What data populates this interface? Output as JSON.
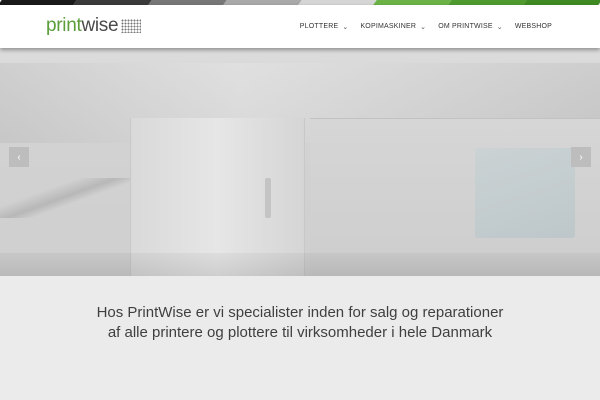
{
  "brand": {
    "logo_part1": "print",
    "logo_part2": "wise",
    "accent_color": "#5b9e3a"
  },
  "top_stripe_colors": [
    "#1a1a1a",
    "#3a3a3a",
    "#777777",
    "#a9a9a9",
    "#d6d6d6",
    "#6bb346",
    "#4f9a2f",
    "#3f8a22"
  ],
  "nav": {
    "items": [
      {
        "label": "PLOTTERE",
        "has_dropdown": true,
        "icon": "chevron-down-icon"
      },
      {
        "label": "KOPIMASKINER",
        "has_dropdown": true,
        "icon": "chevron-down-icon"
      },
      {
        "label": "OM PRINTWISE",
        "has_dropdown": true,
        "icon": "chevron-down-icon"
      },
      {
        "label": "WEBSHOP",
        "has_dropdown": false
      }
    ]
  },
  "slider": {
    "prev_icon": "chevron-left-icon",
    "next_icon": "chevron-right-icon"
  },
  "tagline": {
    "line1": "Hos PrintWise er vi specialister inden for salg og reparationer",
    "line2": "af alle printere og plottere til virksomheder i hele Danmark"
  }
}
